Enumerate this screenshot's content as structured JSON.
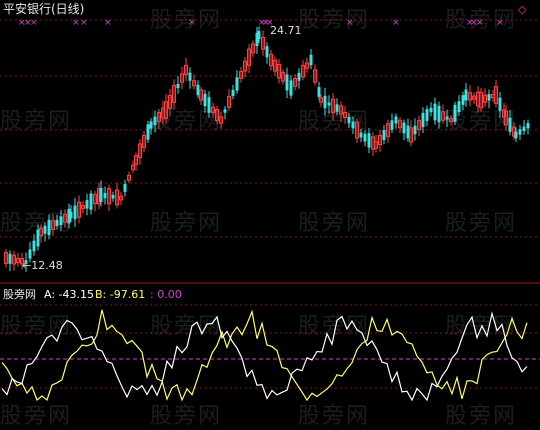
{
  "top_panel": {
    "title": "平安银行(日线)",
    "high_label": "24.71",
    "low_label": "12.48",
    "corner_marker": "◇",
    "colors": {
      "up": "#ff4040",
      "down": "#40e0e0",
      "marker": "#cc44cc",
      "grid": "#7a1a1a",
      "text": "#dddddd"
    }
  },
  "indicator_panel": {
    "name": "股旁网",
    "a_label": "A: -43.15",
    "b_label": "B: -97.61",
    "extra_label": ": 0.00",
    "colors": {
      "a": "#ffffff",
      "b": "#ffff66",
      "extra": "#cc44cc",
      "zero_line": "#cc44cc"
    }
  },
  "watermark": "股旁网"
}
